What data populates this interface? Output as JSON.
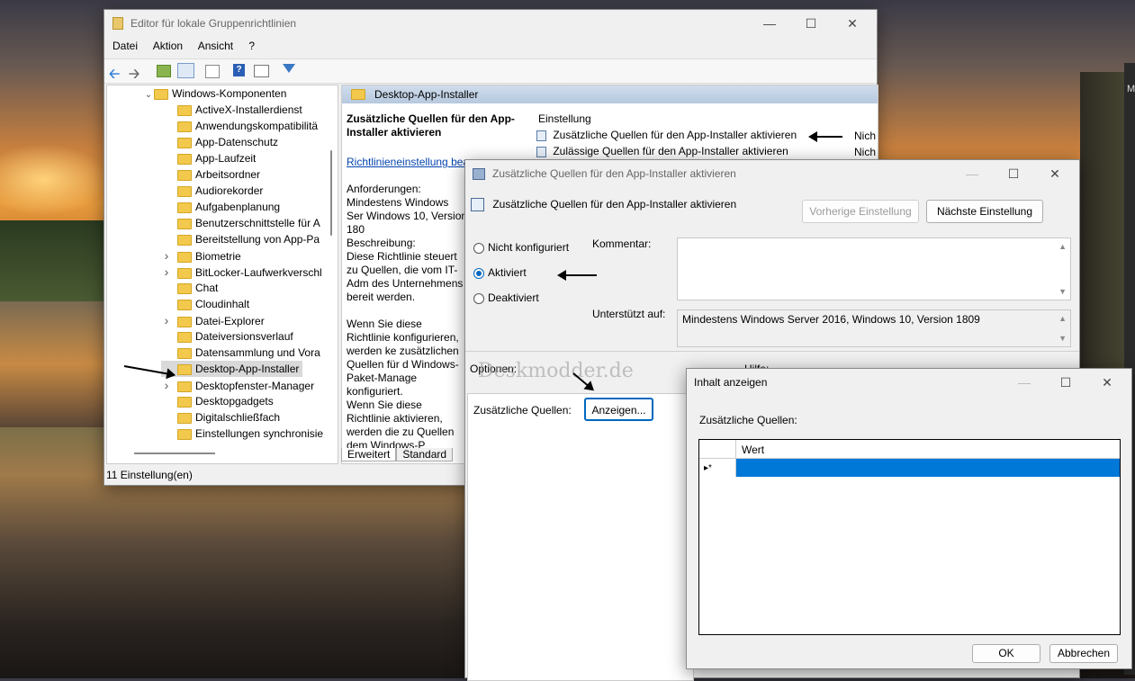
{
  "gpedit": {
    "title": "Editor für lokale Gruppenrichtlinien",
    "menu": [
      "Datei",
      "Aktion",
      "Ansicht",
      "?"
    ],
    "tree": {
      "parent": "Windows-Komponenten",
      "items": [
        {
          "label": "ActiveX-Installerdienst",
          "expandable": false
        },
        {
          "label": "Anwendungskompatibilitä",
          "expandable": false
        },
        {
          "label": "App-Datenschutz",
          "expandable": false
        },
        {
          "label": "App-Laufzeit",
          "expandable": false
        },
        {
          "label": "Arbeitsordner",
          "expandable": false
        },
        {
          "label": "Audiorekorder",
          "expandable": false
        },
        {
          "label": "Aufgabenplanung",
          "expandable": false
        },
        {
          "label": "Benutzerschnittstelle für A",
          "expandable": false
        },
        {
          "label": "Bereitstellung von App-Pa",
          "expandable": false
        },
        {
          "label": "Biometrie",
          "expandable": true
        },
        {
          "label": "BitLocker-Laufwerkverschl",
          "expandable": true
        },
        {
          "label": "Chat",
          "expandable": false
        },
        {
          "label": "Cloudinhalt",
          "expandable": false
        },
        {
          "label": "Datei-Explorer",
          "expandable": true
        },
        {
          "label": "Dateiversionsverlauf",
          "expandable": false
        },
        {
          "label": "Datensammlung und Vora",
          "expandable": false
        },
        {
          "label": "Desktop-App-Installer",
          "expandable": false,
          "selected": true
        },
        {
          "label": "Desktopfenster-Manager",
          "expandable": true
        },
        {
          "label": "Desktopgadgets",
          "expandable": false
        },
        {
          "label": "Digitalschließfach",
          "expandable": false
        },
        {
          "label": "Einstellungen synchronisie",
          "expandable": false
        }
      ]
    },
    "right_header": "Desktop-App-Installer",
    "desc_title": "Zusätzliche Quellen für den App-Installer aktivieren",
    "desc_link": "Richtlinieneinstellung bea",
    "desc_req_label": "Anforderungen:",
    "desc_req_text": "Mindestens Windows Ser Windows 10, Version 180",
    "desc_label": "Beschreibung:",
    "desc_text1": "Diese Richtlinie steuert zu Quellen, die vom IT-Adm des Unternehmens bereit werden.",
    "desc_text2": "Wenn Sie diese Richtlinie konfigurieren, werden ke zusätzlichen Quellen für d Windows-Paket-Manage konfiguriert.",
    "desc_text3": "Wenn Sie diese Richtlinie aktivieren, werden die zu Quellen dem Windows-P",
    "list_header": "Einstellung",
    "list_items": [
      {
        "label": "Zusätzliche Quellen für den App-Installer aktivieren",
        "state": "Nich"
      },
      {
        "label": "Zulässige Quellen für den App-Installer aktivieren",
        "state": "Nich"
      }
    ],
    "tabs": [
      "Erweitert",
      "Standard"
    ],
    "status": "11 Einstellung(en)"
  },
  "policy": {
    "title": "Zusätzliche Quellen für den App-Installer aktivieren",
    "heading": "Zusätzliche Quellen für den App-Installer aktivieren",
    "prev_btn": "Vorherige Einstellung",
    "next_btn": "Nächste Einstellung",
    "radio_not_configured": "Nicht konfiguriert",
    "radio_enabled": "Aktiviert",
    "radio_disabled": "Deaktiviert",
    "comment_label": "Kommentar:",
    "supported_label": "Unterstützt auf:",
    "supported_value": "Mindestens Windows Server 2016, Windows 10, Version 1809",
    "options_label": "Optionen:",
    "help_label": "Hilfe:",
    "sources_label": "Zusätzliche Quellen:",
    "show_btn": "Anzeigen..."
  },
  "watermark": "Deskmodder.de",
  "show_dialog": {
    "title": "Inhalt anzeigen",
    "label": "Zusätzliche Quellen:",
    "column": "Wert",
    "row_marker": "▸*",
    "ok": "OK",
    "cancel": "Abbrechen"
  },
  "edge_text": "M"
}
